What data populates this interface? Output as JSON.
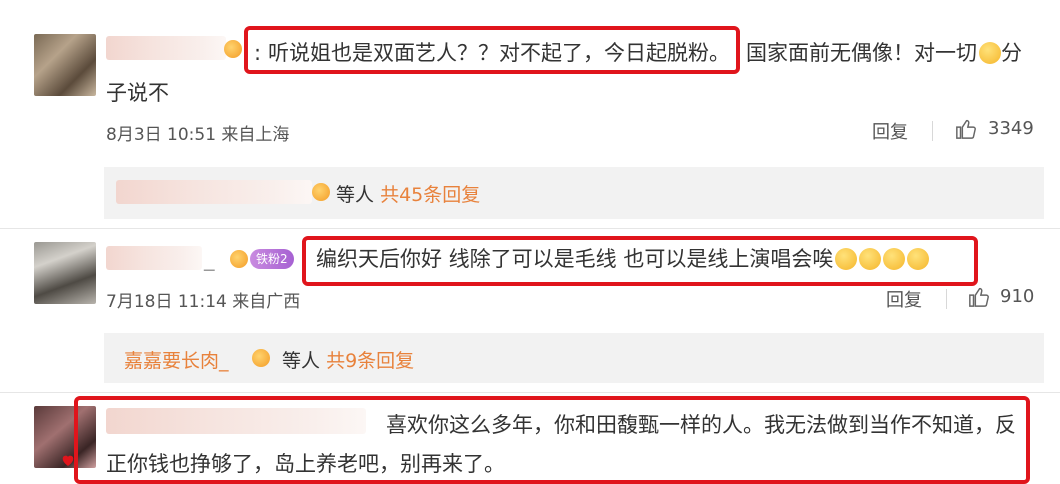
{
  "comments": [
    {
      "name_suffix": ":",
      "text_boxed": "听说姐也是双面艺人？？对不起了，今日起脱粉。",
      "text_rest": "国家面前无偶像！对一切",
      "text_rest2": "分",
      "text_line2": "子说不",
      "meta": "8月3日 10:51 来自上海",
      "reply_label": "回复",
      "like_count": "3349",
      "replies_by": "等人",
      "replies_count": "共45条回复"
    },
    {
      "name_tail": "_",
      "badge": "铁粉2",
      "text_boxed": "编织天后你好 线除了可以是毛线 也可以是线上演唱会唉",
      "meta": "7月18日 11:14 来自广西",
      "reply_label": "回复",
      "like_count": "910",
      "replier_name": "嘉嘉要长肉_",
      "replies_by": "等人",
      "replies_count": "共9条回复"
    },
    {
      "text_line1": "喜欢你这么多年，你和田馥甄一样的人。我无法做到当作不知道，反",
      "text_line2": "正你钱也挣够了，岛上养老吧，别再来了。"
    }
  ],
  "colors": {
    "highlight_box": "#e0151c",
    "reply_accent": "#e8823c"
  }
}
